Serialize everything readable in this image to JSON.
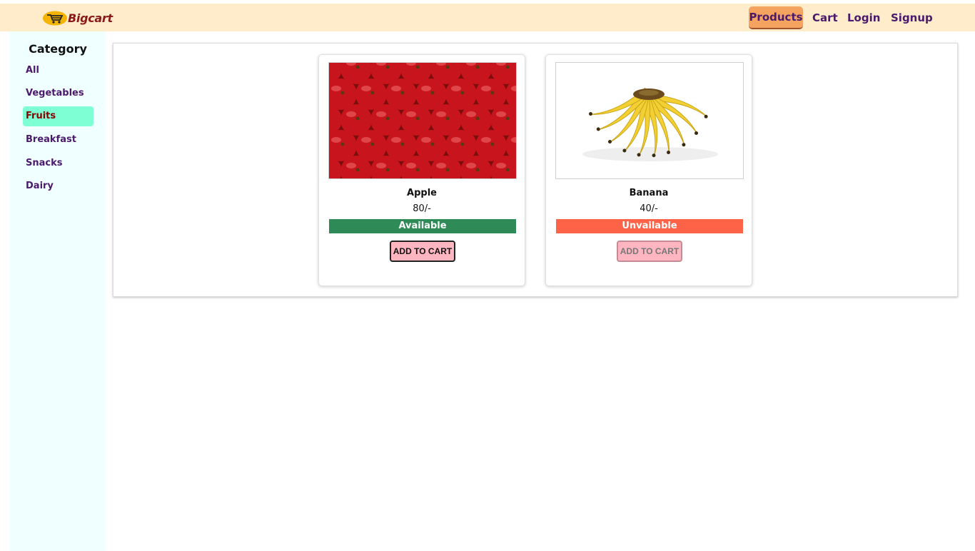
{
  "header": {
    "brand": "Bigcart",
    "nav": {
      "products": "Products",
      "cart": "Cart",
      "login": "Login",
      "signup": "Signup"
    }
  },
  "sidebar": {
    "title": "Category",
    "items": [
      {
        "label": "All",
        "active": false
      },
      {
        "label": "Vegetables",
        "active": false
      },
      {
        "label": "Fruits",
        "active": true
      },
      {
        "label": "Breakfast",
        "active": false
      },
      {
        "label": "Snacks",
        "active": false
      },
      {
        "label": "Dairy",
        "active": false
      }
    ]
  },
  "products": [
    {
      "name": "Apple",
      "price": "80/-",
      "status": "Available",
      "status_color": "#2e8b57",
      "button": "ADD TO CART",
      "button_enabled": true
    },
    {
      "name": "Banana",
      "price": "40/-",
      "status": "Unvailable",
      "status_color": "#ff6347",
      "button": "ADD TO CART",
      "button_enabled": false
    }
  ],
  "colors": {
    "navbar_bg": "#ffecca",
    "active_nav": "#f4a460",
    "sidebar_bg": "#f0ffff",
    "active_category": "#7fffd4",
    "button_bg": "#ffb6c1"
  }
}
